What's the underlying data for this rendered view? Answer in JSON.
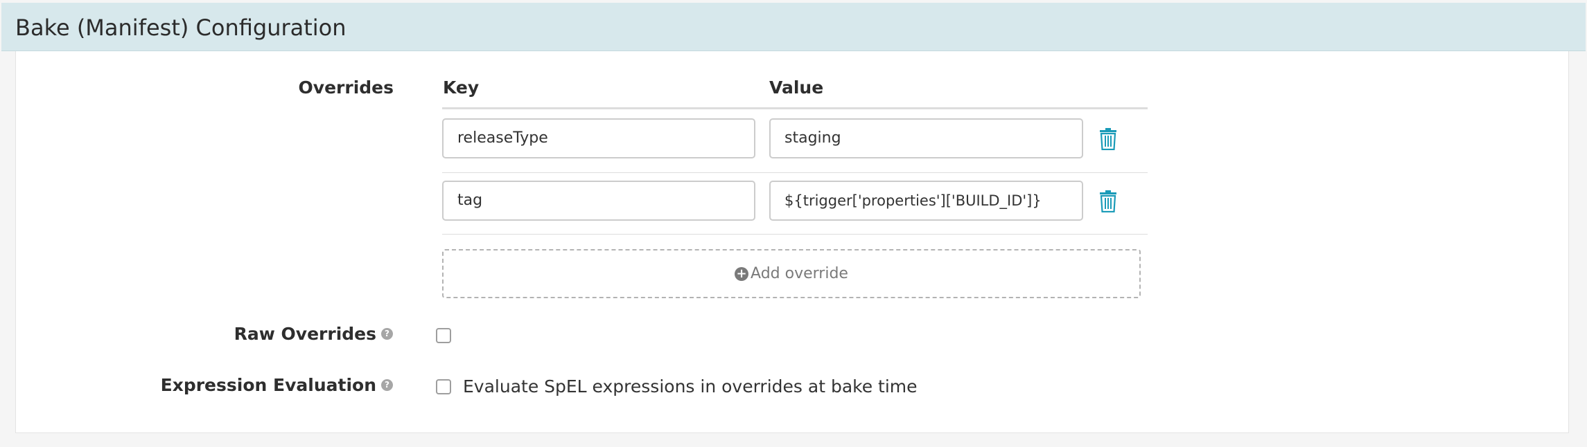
{
  "header": {
    "title": "Bake (Manifest) Configuration"
  },
  "overrides": {
    "label": "Overrides",
    "columns": {
      "key": "Key",
      "value": "Value"
    },
    "rows": [
      {
        "key": "releaseType",
        "value": "staging"
      },
      {
        "key": "tag",
        "value": "${trigger['properties']['BUILD_ID']}"
      }
    ],
    "add_label": "Add override",
    "icons": {
      "delete": "trash-icon",
      "add": "plus-circle-icon"
    },
    "accent_color": "#1a9bb8"
  },
  "raw_overrides": {
    "label": "Raw Overrides",
    "checked": false,
    "help_icon": "question-circle-icon"
  },
  "expression_evaluation": {
    "label": "Expression Evaluation",
    "checked": false,
    "checkbox_label": "Evaluate SpEL expressions in overrides at bake time",
    "help_icon": "question-circle-icon"
  }
}
